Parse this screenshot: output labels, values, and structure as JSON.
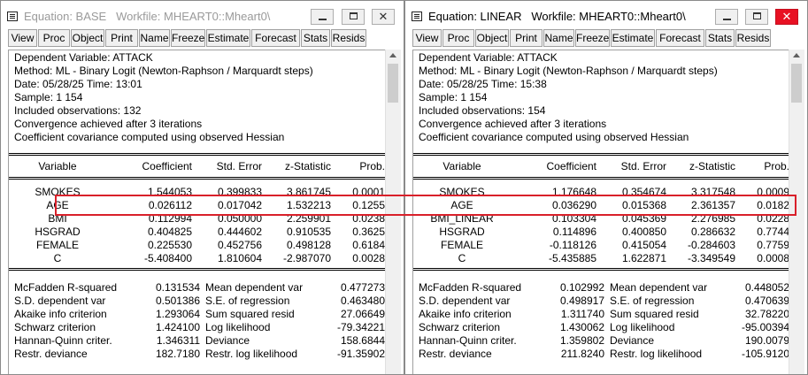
{
  "windows": [
    {
      "title": "Equation: BASE   Workfile: MHEART0::Mheart0\\",
      "active": false,
      "toolbar": [
        "View",
        "Proc",
        "Object",
        "Print",
        "Name",
        "Freeze",
        "Estimate",
        "Forecast",
        "Stats",
        "Resids"
      ],
      "header": [
        "Dependent Variable: ATTACK",
        "Method: ML - Binary Logit (Newton-Raphson / Marquardt steps)",
        "Date: 05/28/25   Time: 13:01",
        "Sample: 1 154",
        "Included observations: 132",
        "Convergence achieved after 3 iterations",
        "Coefficient covariance computed using observed Hessian"
      ],
      "columns": [
        "Variable",
        "Coefficient",
        "Std. Error",
        "z-Statistic",
        "Prob."
      ],
      "rows": [
        [
          "SMOKES",
          "1.544053",
          "0.399833",
          "3.861745",
          "0.0001"
        ],
        [
          "AGE",
          "0.026112",
          "0.017042",
          "1.532213",
          "0.1255"
        ],
        [
          "BMI",
          "0.112994",
          "0.050000",
          "2.259901",
          "0.0238"
        ],
        [
          "HSGRAD",
          "0.404825",
          "0.444602",
          "0.910535",
          "0.3625"
        ],
        [
          "FEMALE",
          "0.225530",
          "0.452756",
          "0.498128",
          "0.6184"
        ],
        [
          "C",
          "-5.408400",
          "1.810604",
          "-2.987070",
          "0.0028"
        ]
      ],
      "stats": [
        [
          "McFadden R-squared",
          "0.131534",
          "Mean dependent var",
          "0.477273"
        ],
        [
          "S.D. dependent var",
          "0.501386",
          "S.E. of regression",
          "0.463480"
        ],
        [
          "Akaike info criterion",
          "1.293064",
          "Sum squared resid",
          "27.06649"
        ],
        [
          "Schwarz criterion",
          "1.424100",
          "Log likelihood",
          "-79.34221"
        ],
        [
          "Hannan-Quinn criter.",
          "1.346311",
          "Deviance",
          "158.6844"
        ],
        [
          "Restr. deviance",
          "182.7180",
          "Restr. log likelihood",
          "-91.35902"
        ]
      ]
    },
    {
      "title": "Equation: LINEAR   Workfile: MHEART0::Mheart0\\",
      "active": true,
      "toolbar": [
        "View",
        "Proc",
        "Object",
        "Print",
        "Name",
        "Freeze",
        "Estimate",
        "Forecast",
        "Stats",
        "Resids"
      ],
      "header": [
        "Dependent Variable: ATTACK",
        "Method: ML - Binary Logit (Newton-Raphson / Marquardt steps)",
        "Date: 05/28/25   Time: 15:38",
        "Sample: 1 154",
        "Included observations: 154",
        "Convergence achieved after 3 iterations",
        "Coefficient covariance computed using observed Hessian"
      ],
      "columns": [
        "Variable",
        "Coefficient",
        "Std. Error",
        "z-Statistic",
        "Prob."
      ],
      "rows": [
        [
          "SMOKES",
          "1.176648",
          "0.354674",
          "3.317548",
          "0.0009"
        ],
        [
          "AGE",
          "0.036290",
          "0.015368",
          "2.361357",
          "0.0182"
        ],
        [
          "BMI_LINEAR",
          "0.103304",
          "0.045369",
          "2.276985",
          "0.0228"
        ],
        [
          "HSGRAD",
          "0.114896",
          "0.400850",
          "0.286632",
          "0.7744"
        ],
        [
          "FEMALE",
          "-0.118126",
          "0.415054",
          "-0.284603",
          "0.7759"
        ],
        [
          "C",
          "-5.435885",
          "1.622871",
          "-3.349549",
          "0.0008"
        ]
      ],
      "stats": [
        [
          "McFadden R-squared",
          "0.102992",
          "Mean dependent var",
          "0.448052"
        ],
        [
          "S.D. dependent var",
          "0.498917",
          "S.E. of regression",
          "0.470639"
        ],
        [
          "Akaike info criterion",
          "1.311740",
          "Sum squared resid",
          "32.78220"
        ],
        [
          "Schwarz criterion",
          "1.430062",
          "Log likelihood",
          "-95.00394"
        ],
        [
          "Hannan-Quinn criter.",
          "1.359802",
          "Deviance",
          "190.0079"
        ],
        [
          "Restr. deviance",
          "211.8240",
          "Restr. log likelihood",
          "-105.9120"
        ]
      ]
    }
  ],
  "colors": {
    "highlight": "#d9202a",
    "close_active": "#e81123"
  },
  "icons": {
    "window": "equation-window-icon",
    "minimize": "minimize-icon",
    "maximize": "maximize-icon",
    "close": "close-icon"
  }
}
